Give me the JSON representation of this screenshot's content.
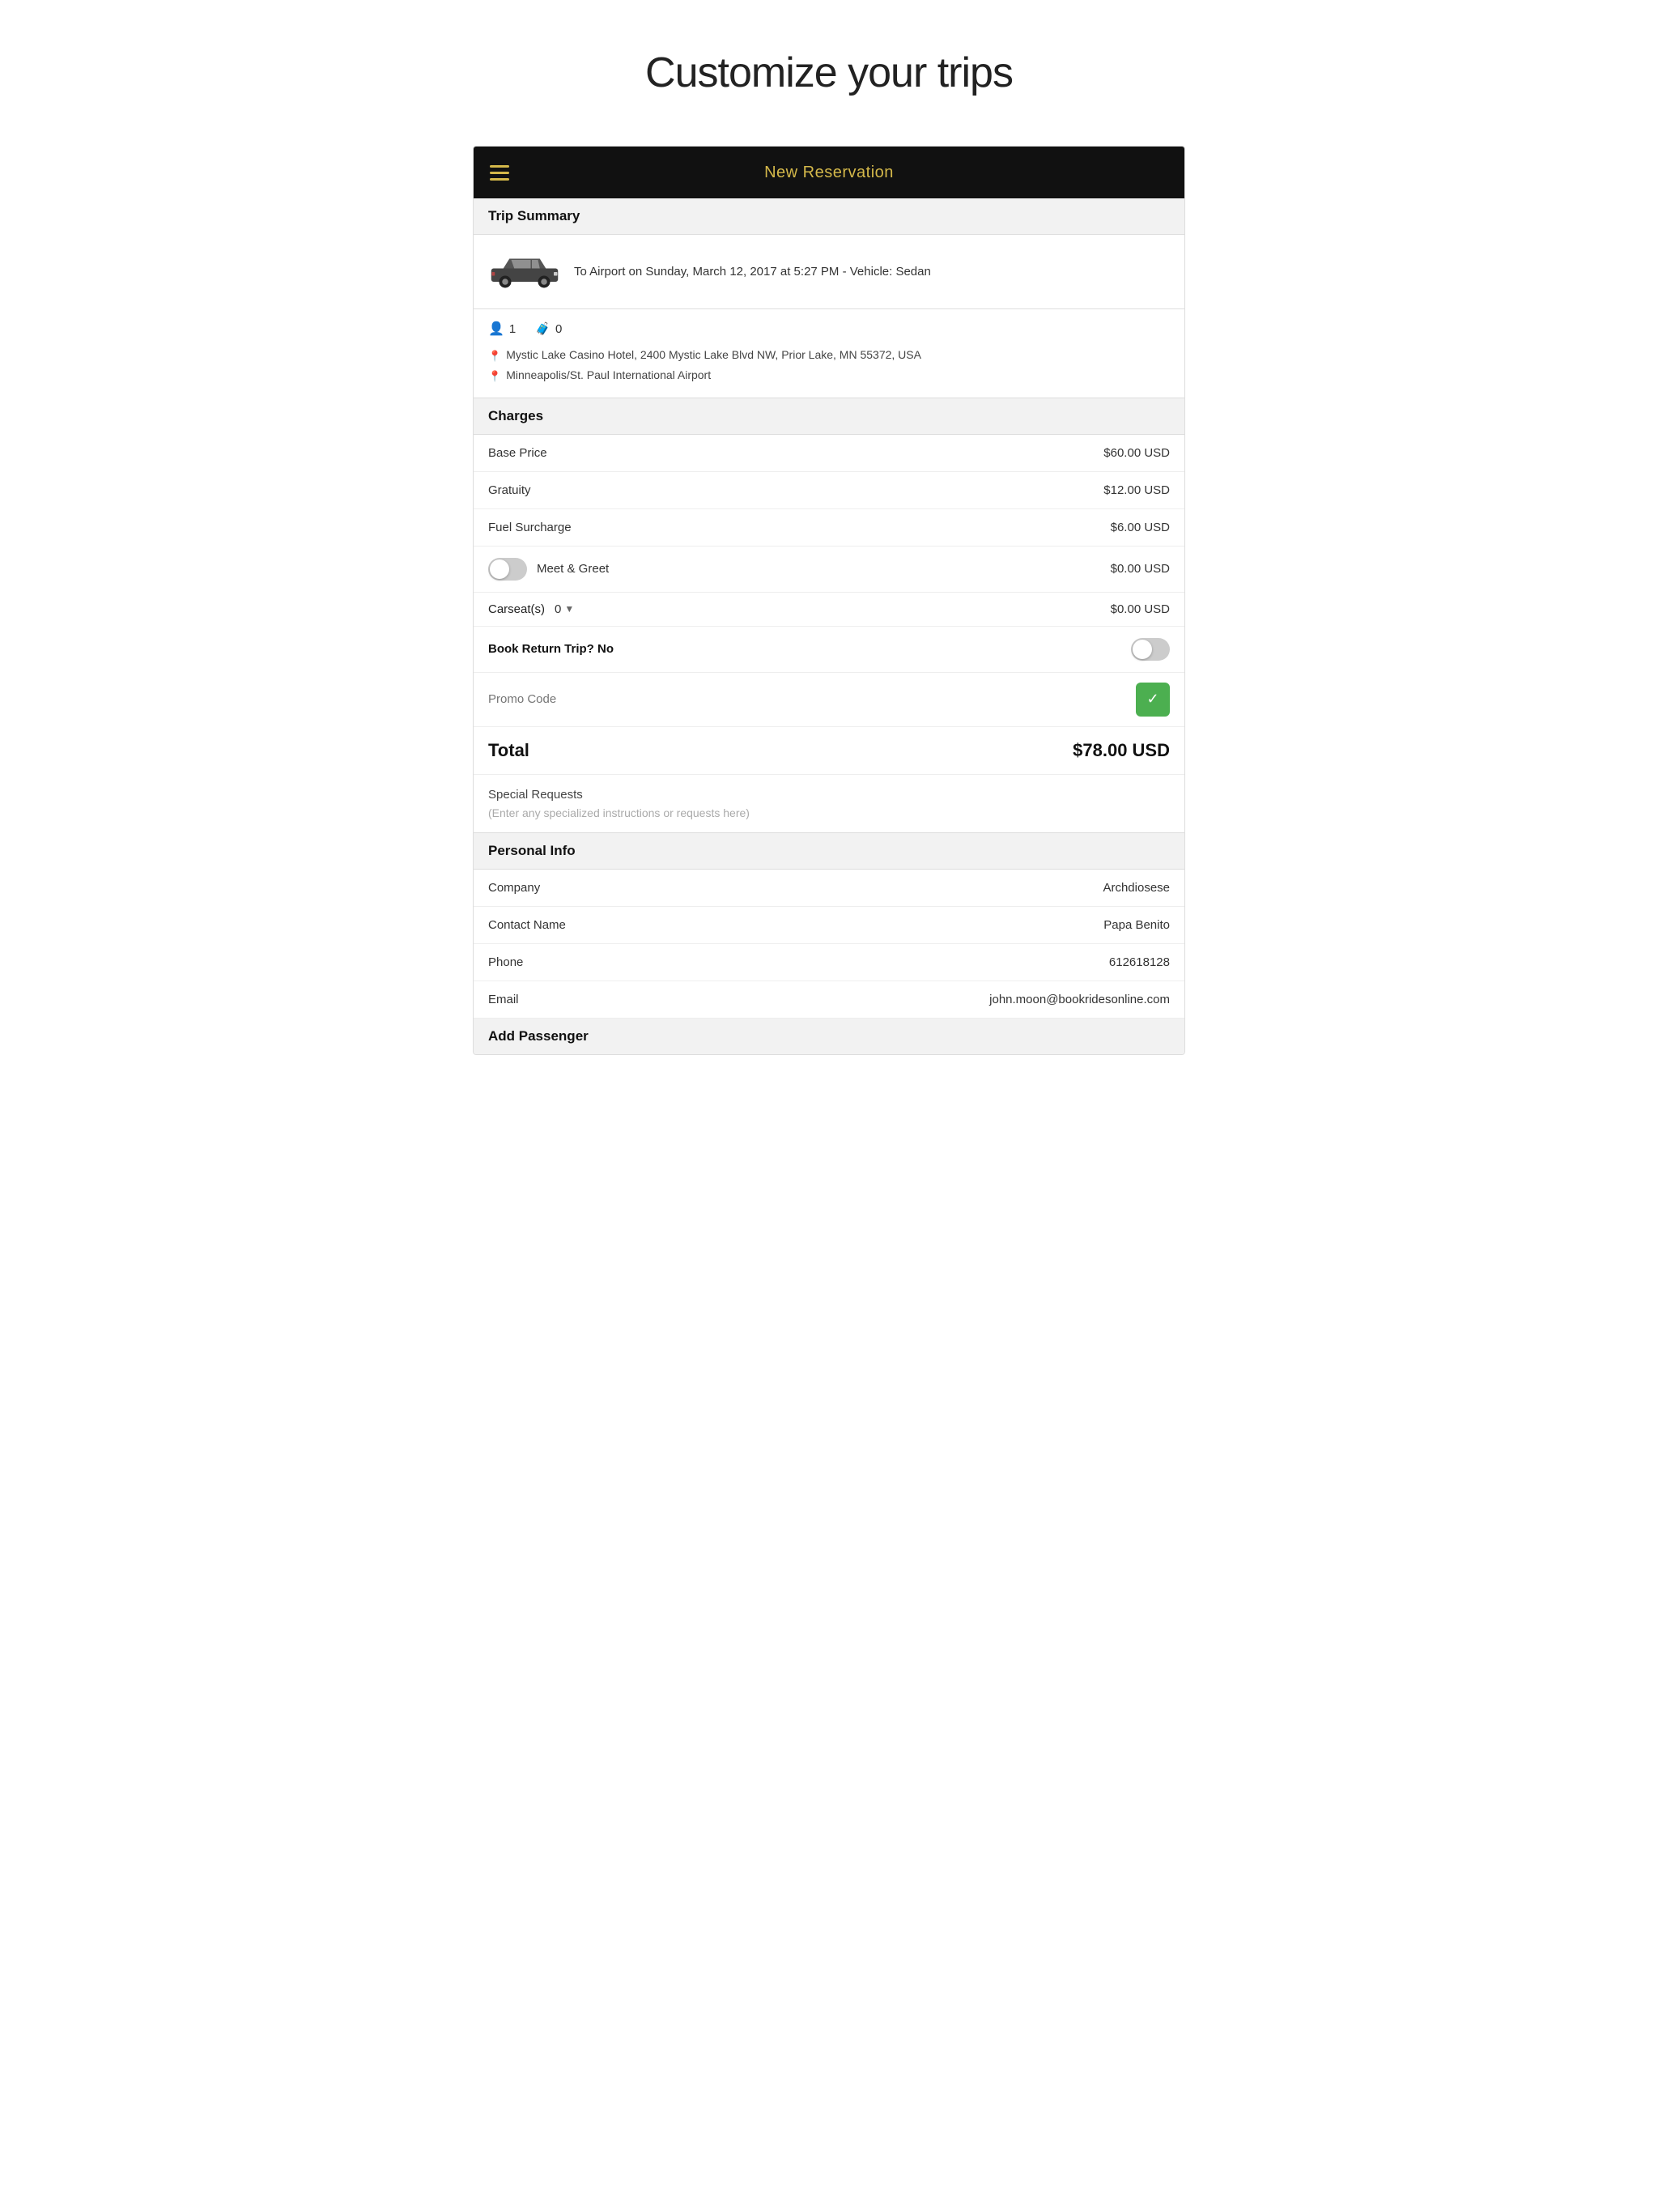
{
  "page": {
    "title": "Customize your trips"
  },
  "nav": {
    "title": "New Reservation",
    "hamburger_label": "Menu"
  },
  "trip_summary": {
    "section_label": "Trip Summary",
    "description": "To Airport on Sunday, March 12, 2017 at 5:27 PM - Vehicle: Sedan",
    "passengers": "1",
    "luggage": "0",
    "pickup": "Mystic Lake Casino Hotel, 2400 Mystic Lake Blvd NW, Prior Lake, MN 55372, USA",
    "dropoff": "Minneapolis/St. Paul International Airport"
  },
  "charges": {
    "section_label": "Charges",
    "items": [
      {
        "label": "Base Price",
        "amount": "$60.00 USD"
      },
      {
        "label": "Gratuity",
        "amount": "$12.00 USD"
      },
      {
        "label": "Fuel Surcharge",
        "amount": "$6.00 USD"
      }
    ],
    "meet_greet": {
      "label": "Meet & Greet",
      "amount": "$0.00 USD",
      "enabled": false
    },
    "carseat": {
      "label": "Carseat(s)",
      "quantity": "0",
      "amount": "$0.00 USD"
    },
    "book_return": {
      "label": "Book Return Trip?",
      "value": "No",
      "enabled": false
    },
    "promo": {
      "placeholder": "Promo Code",
      "button_icon": "✓"
    },
    "total": {
      "label": "Total",
      "amount": "$78.00 USD"
    }
  },
  "special_requests": {
    "label": "Special Requests",
    "placeholder": "(Enter any specialized instructions or requests here)"
  },
  "personal_info": {
    "section_label": "Personal Info",
    "fields": [
      {
        "label": "Company",
        "value": "Archdiosese"
      },
      {
        "label": "Contact Name",
        "value": "Papa Benito"
      },
      {
        "label": "Phone",
        "value": "612618128"
      },
      {
        "label": "Email",
        "value": "john.moon@bookridesonline.com"
      }
    ]
  },
  "add_passenger": {
    "label": "Add Passenger"
  }
}
